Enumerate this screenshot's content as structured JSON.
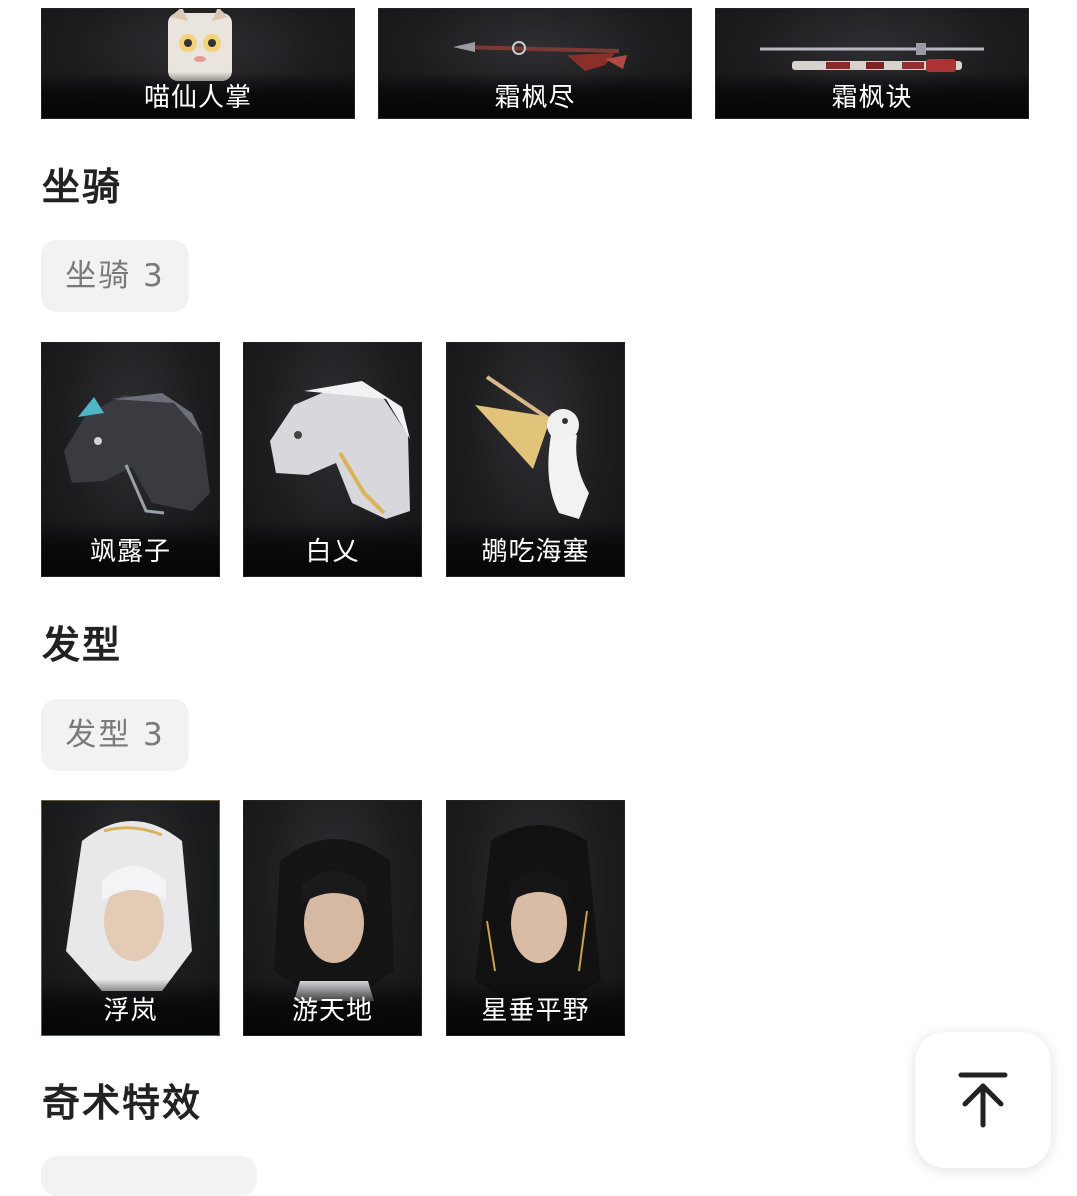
{
  "weapons": {
    "items": [
      {
        "label": "喵仙人掌",
        "icon": "cat-weapon-icon"
      },
      {
        "label": "霜枫尽",
        "icon": "spear-icon"
      },
      {
        "label": "霜枫诀",
        "icon": "sword-icon"
      }
    ]
  },
  "mounts": {
    "title": "坐骑",
    "chip": "坐骑 3",
    "items": [
      {
        "label": "飒露子",
        "icon": "black-horse-icon"
      },
      {
        "label": "白乂",
        "icon": "white-horse-icon"
      },
      {
        "label": "鹕吃海塞",
        "icon": "pelican-icon"
      }
    ]
  },
  "hairstyles": {
    "title": "发型",
    "chip": "发型 3",
    "items": [
      {
        "label": "浮岚",
        "icon": "white-hair-portrait-icon"
      },
      {
        "label": "游天地",
        "icon": "black-hair-portrait-icon"
      },
      {
        "label": "星垂平野",
        "icon": "long-black-hair-portrait-icon"
      }
    ]
  },
  "effects": {
    "title": "奇术特效"
  },
  "colors": {
    "card_bg": "#1d1d20",
    "chip_bg": "#f2f2f2",
    "chip_text": "#7a7a7a"
  }
}
